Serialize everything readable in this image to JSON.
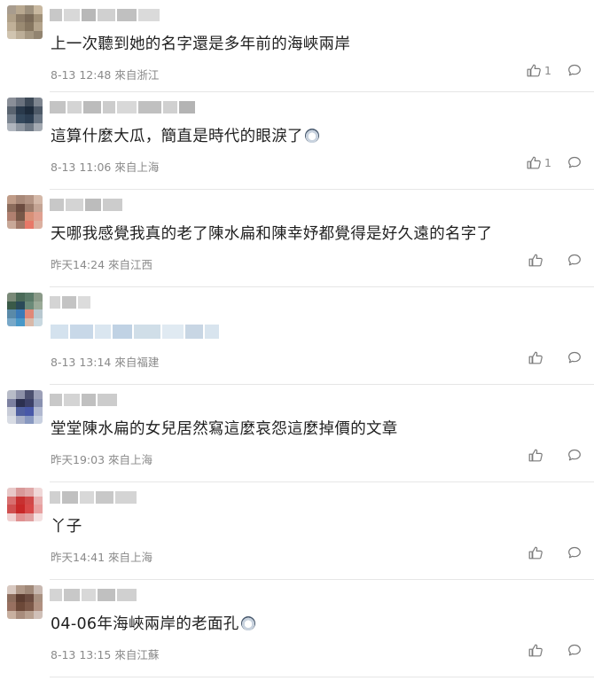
{
  "comments": [
    {
      "avatar_colors": [
        "#a89c8e",
        "#b8a890",
        "#9c8f7c",
        "#c8b8a0",
        "#b0a088",
        "#8c7c68",
        "#7a6a58",
        "#a09078",
        "#c0b098",
        "#9a8a72",
        "#867660",
        "#b4a48c",
        "#d0c4b0",
        "#bcae98",
        "#a49680",
        "#928470"
      ],
      "username_blocks": [
        "#c8c8c8",
        "#d8d8d8",
        "#b8b8b8",
        "#d0d0d0",
        "#c0c0c0",
        "#dadada"
      ],
      "text": "上一次聽到她的名字還是多年前的海峽兩岸",
      "emoji": false,
      "timestamp": "8-13 12:48 來自浙江",
      "like_count": "1"
    },
    {
      "avatar_colors": [
        "#8a8f98",
        "#6a727e",
        "#3e4a58",
        "#7e8690",
        "#5a6470",
        "#2a3a4c",
        "#1e2c3c",
        "#4e5a68",
        "#7a8490",
        "#34485c",
        "#2c3e52",
        "#6a7684",
        "#b0b6be",
        "#8e96a0",
        "#707a86",
        "#a4aab2"
      ],
      "username_blocks": [
        "#c4c4c4",
        "#d4d4d4",
        "#bcbcbc",
        "#cccccc",
        "#d8d8d8",
        "#c0c0c0",
        "#d0d0d0",
        "#b4b4b4"
      ],
      "text": "這算什麼大瓜，簡直是時代的眼淚了",
      "emoji": true,
      "timestamp": "8-13 11:06 來自上海",
      "like_count": "1"
    },
    {
      "avatar_colors": [
        "#c09c88",
        "#a88878",
        "#b49484",
        "#d4b8a8",
        "#8c6c5c",
        "#6c4c40",
        "#9c7c6c",
        "#c4a494",
        "#b08070",
        "#785848",
        "#d89078",
        "#e0a090",
        "#c8a898",
        "#a07868",
        "#e87868",
        "#dcb0a0"
      ],
      "username_blocks": [
        "#c8c8c8",
        "#d4d4d4",
        "#bcbcbc",
        "#cccccc"
      ],
      "text": "天哪我感覺我真的老了陳水扁和陳幸妤都覺得是好久遠的名字了",
      "emoji": false,
      "timestamp": "昨天14:24 來自江西",
      "like_count": ""
    },
    {
      "avatar_colors": [
        "#7a8a78",
        "#4a6a58",
        "#5a7a68",
        "#8a9a88",
        "#3a5a48",
        "#2a4a58",
        "#6a8a78",
        "#9aaa98",
        "#5a8aa8",
        "#3a7ab8",
        "#e08878",
        "#b8c8d0",
        "#78a8c8",
        "#4898c8",
        "#d8b8a8",
        "#c8d8e0"
      ],
      "username_blocks": [
        "#d4d4d4",
        "#c4c4c4",
        "#dcdcdc"
      ],
      "blurred_blocks": [
        "#d4e2ee",
        "#c8d8e8",
        "#dae6f0",
        "#c0d2e4",
        "#d0dee8",
        "#e0eaf2",
        "#c8d6e4",
        "#d8e4ee"
      ],
      "text": "",
      "emoji": false,
      "timestamp": "8-13 13:14 來自福建",
      "like_count": ""
    },
    {
      "avatar_colors": [
        "#b8bcc8",
        "#8c90a8",
        "#4c5070",
        "#9ca0b8",
        "#7c80a0",
        "#2c3050",
        "#3c4068",
        "#8890b0",
        "#c8ccd8",
        "#5060a0",
        "#4858a8",
        "#b0b8d0",
        "#d8dce4",
        "#a8b0c8",
        "#8898c0",
        "#c8d0e0"
      ],
      "username_blocks": [
        "#c8c8c8",
        "#d4d4d4",
        "#c0c0c0",
        "#cccccc"
      ],
      "text": "堂堂陳水扁的女兒居然寫這麼哀怨這麼掉價的文章",
      "emoji": false,
      "timestamp": "昨天19:03 來自上海",
      "like_count": ""
    },
    {
      "avatar_colors": [
        "#e8c8c8",
        "#d89898",
        "#e0a8a8",
        "#f0d8d8",
        "#d87070",
        "#c83030",
        "#d04848",
        "#e8b0b0",
        "#d05050",
        "#c82828",
        "#d84848",
        "#e8a0a0",
        "#f0d0d0",
        "#e09090",
        "#e0a0a0",
        "#f4e0e0"
      ],
      "username_blocks": [
        "#d0d0d0",
        "#c0c0c0",
        "#d8d8d8",
        "#c8c8c8",
        "#d4d4d4"
      ],
      "text": "丫子",
      "emoji": false,
      "timestamp": "昨天14:41 來自上海",
      "like_count": ""
    },
    {
      "avatar_colors": [
        "#d8c8c0",
        "#b09888",
        "#a08878",
        "#c8b8b0",
        "#8c6c5c",
        "#5c3c30",
        "#6c4c40",
        "#a89080",
        "#987060",
        "#6c4838",
        "#7c5848",
        "#b09080",
        "#c8b0a0",
        "#a88c7c",
        "#b8a090",
        "#d0c0b8"
      ],
      "username_blocks": [
        "#d4d4d4",
        "#c8c8c8",
        "#d8d8d8",
        "#c0c0c0",
        "#d0d0d0"
      ],
      "text": "04-06年海峽兩岸的老面孔",
      "emoji": true,
      "timestamp": "8-13 13:15 來自江蘇",
      "like_count": ""
    }
  ],
  "icons": {
    "like": "thumbs-up-icon",
    "reply": "speech-bubble-icon"
  }
}
